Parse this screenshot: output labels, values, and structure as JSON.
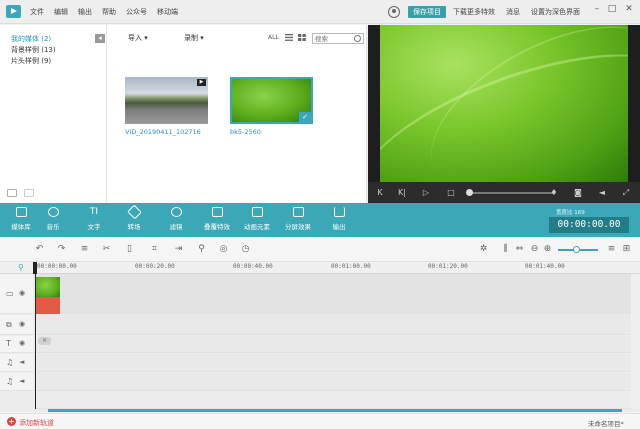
{
  "menu": [
    "文件",
    "编辑",
    "输出",
    "帮助",
    "公众号",
    "移动端"
  ],
  "header": {
    "save_label": "保存项目",
    "download_label": "下载更多特效",
    "messages_label": "消息",
    "settings_label": "设置为深色界面"
  },
  "library": {
    "categories": [
      {
        "label": "我的媒体 (2)",
        "active": true
      },
      {
        "label": "背景样例 (13)",
        "active": false
      },
      {
        "label": "片头样例 (9)",
        "active": false
      }
    ],
    "import_label": "导入 ▾",
    "record_label": "录制 ▾",
    "all_label": "ALL",
    "search_placeholder": "搜索",
    "items": [
      {
        "name": "VID_20190411_102716",
        "type": "video"
      },
      {
        "name": "bk5-2560",
        "type": "image",
        "selected": true
      }
    ]
  },
  "player": {
    "buttons": [
      "K",
      "K|",
      "▷",
      "□",
      "mic",
      "camera",
      "volume",
      "fullscreen"
    ],
    "progress": 0.0
  },
  "tools": [
    {
      "label": "媒体库",
      "icon": "folder-icon"
    },
    {
      "label": "音乐",
      "icon": "music-icon"
    },
    {
      "label": "文字",
      "icon": "text-icon"
    },
    {
      "label": "转场",
      "icon": "transition-icon"
    },
    {
      "label": "滤镜",
      "icon": "filter-icon"
    },
    {
      "label": "叠覆特效",
      "icon": "overlay-icon"
    },
    {
      "label": "动画元素",
      "icon": "elements-icon"
    },
    {
      "label": "分屏效果",
      "icon": "split-screen-icon"
    },
    {
      "label": "输出",
      "icon": "export-icon"
    }
  ],
  "time": {
    "label": "宽度比  169",
    "timecode": "00:00:00.00"
  },
  "ruler": [
    "00:00:00.00",
    "00:00:20.00",
    "00:00:40.00",
    "00:01:00.00",
    "00:01:20.00",
    "00:01:40.00"
  ],
  "zoom": {
    "level": 0.45
  },
  "footer": {
    "add_track": "添加新轨道",
    "project": "未命名项目*"
  },
  "colors": {
    "accent": "#3aa8b7",
    "audio_clip": "#e25b45",
    "preview_bg": "#1e1e1e"
  }
}
